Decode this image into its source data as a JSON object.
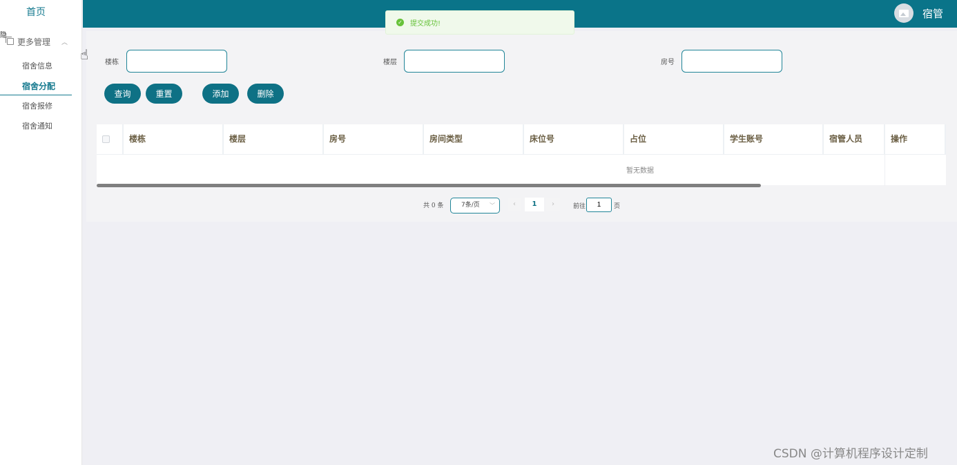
{
  "sidebar": {
    "home_label": "首页",
    "group_label": "更多管理",
    "cut_text": "隐",
    "items": [
      {
        "label": "宿舍信息"
      },
      {
        "label": "宿舍分配"
      },
      {
        "label": "宿舍报修"
      },
      {
        "label": "宿舍通知"
      }
    ]
  },
  "header": {
    "user_name": "宿管",
    "bar_color": "#0a7489"
  },
  "toast": {
    "message": "提交成功!",
    "icon": "check-circle-icon",
    "color": "#67c23a"
  },
  "search": {
    "building_label": "楼栋",
    "floor_label": "楼层",
    "room_label": "房号",
    "building_value": "",
    "floor_value": "",
    "room_value": ""
  },
  "actions": {
    "query_label": "查询",
    "reset_label": "重置",
    "add_label": "添加",
    "delete_label": "删除"
  },
  "table": {
    "columns": [
      "楼栋",
      "楼层",
      "房号",
      "房间类型",
      "床位号",
      "占位",
      "学生账号",
      "宿管人员",
      "操作"
    ],
    "rows": [],
    "empty_text": "暂无数据"
  },
  "pagination": {
    "total_text": "共 0 条",
    "page_size": "7条/页",
    "current_page": "1",
    "goto_label": "前往",
    "goto_value": "1",
    "page_unit": "页"
  },
  "watermark": "CSDN @计算机程序设计定制"
}
